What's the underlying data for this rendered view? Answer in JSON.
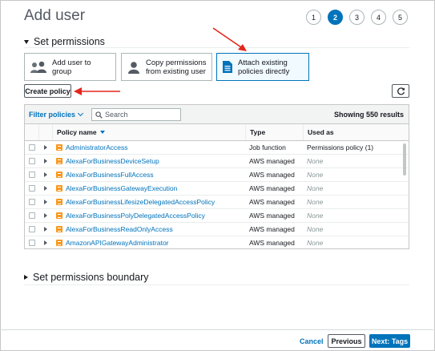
{
  "page": {
    "title": "Add user"
  },
  "wizard": {
    "steps": [
      "1",
      "2",
      "3",
      "4",
      "5"
    ],
    "active_step": "2"
  },
  "permissions_section": {
    "label": "Set permissions"
  },
  "options": [
    {
      "label": "Add user to group",
      "icon": "group-icon",
      "selected": false
    },
    {
      "label": "Copy permissions from existing user",
      "icon": "user-icon",
      "selected": false
    },
    {
      "label": "Attach existing policies directly",
      "icon": "policy-document-icon",
      "selected": true
    }
  ],
  "actions": {
    "create_policy": "Create policy",
    "refresh_icon": "refresh-icon"
  },
  "table": {
    "filter_label": "Filter policies",
    "search_placeholder": "Search",
    "showing": "Showing 550 results",
    "columns": {
      "name": "Policy name",
      "type": "Type",
      "used_as": "Used as"
    },
    "rows": [
      {
        "name": "AdministratorAccess",
        "type": "Job function",
        "used_as": "Permissions policy (1)"
      },
      {
        "name": "AlexaForBusinessDeviceSetup",
        "type": "AWS managed",
        "used_as": "None"
      },
      {
        "name": "AlexaForBusinessFullAccess",
        "type": "AWS managed",
        "used_as": "None"
      },
      {
        "name": "AlexaForBusinessGatewayExecution",
        "type": "AWS managed",
        "used_as": "None"
      },
      {
        "name": "AlexaForBusinessLifesizeDelegatedAccessPolicy",
        "type": "AWS managed",
        "used_as": "None"
      },
      {
        "name": "AlexaForBusinessPolyDelegatedAccessPolicy",
        "type": "AWS managed",
        "used_as": "None"
      },
      {
        "name": "AlexaForBusinessReadOnlyAccess",
        "type": "AWS managed",
        "used_as": "None"
      },
      {
        "name": "AmazonAPIGatewayAdministrator",
        "type": "AWS managed",
        "used_as": "None"
      }
    ]
  },
  "boundary_section": {
    "label": "Set permissions boundary"
  },
  "footer": {
    "cancel": "Cancel",
    "previous": "Previous",
    "next": "Next: Tags"
  },
  "colors": {
    "accent": "#0073bb",
    "primary_button": "#0073bb",
    "annotation_arrow": "#e3261b",
    "policy_icon": "#f7981f"
  }
}
